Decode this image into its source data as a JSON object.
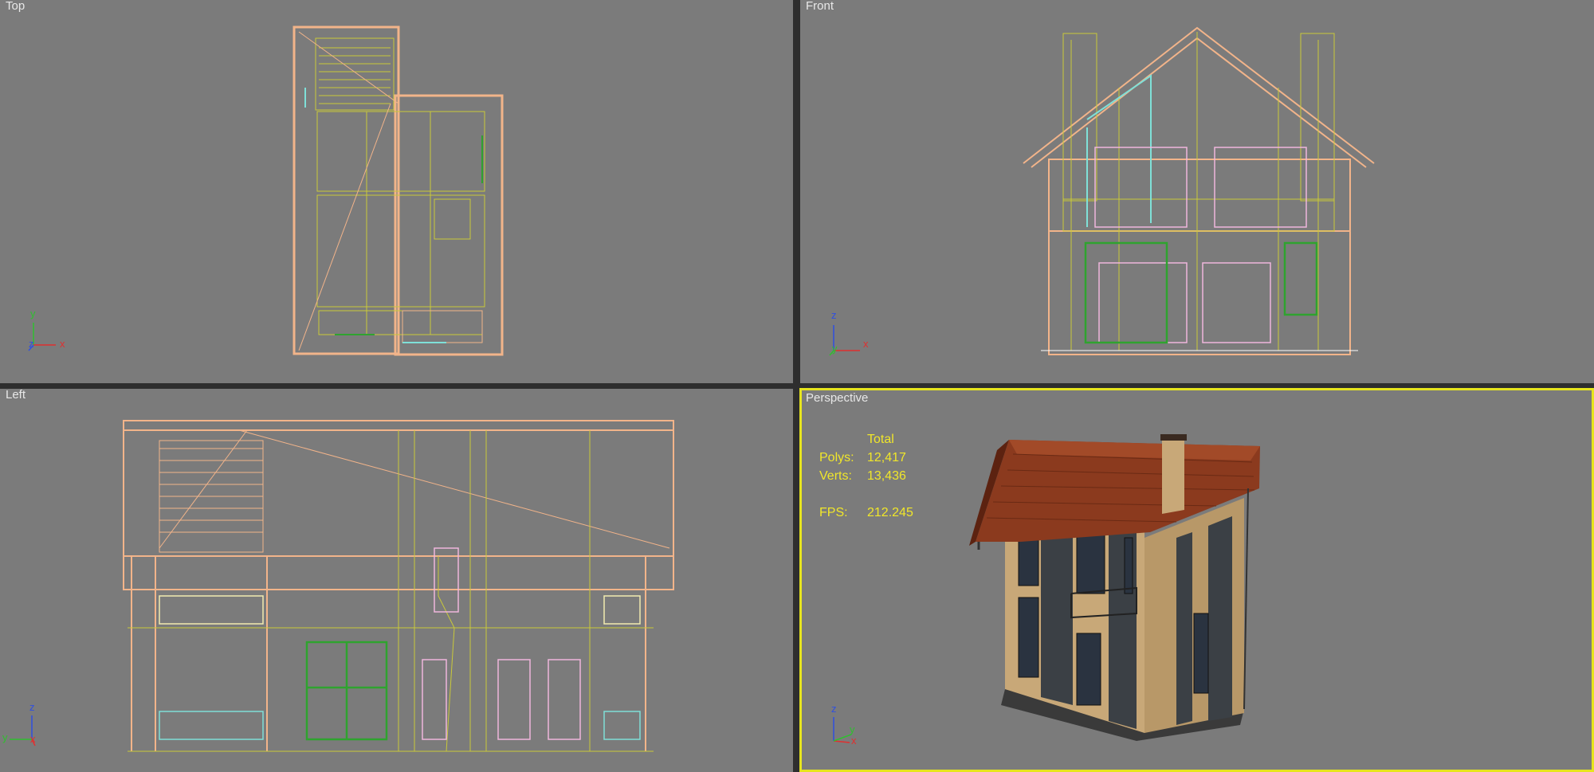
{
  "viewports": {
    "top": {
      "label": "Top"
    },
    "front": {
      "label": "Front"
    },
    "left": {
      "label": "Left"
    },
    "perspective": {
      "label": "Perspective",
      "active": true
    }
  },
  "stats": {
    "header": "Total",
    "polys_label": "Polys:",
    "polys_value": "12,417",
    "verts_label": "Verts:",
    "verts_value": "13,436",
    "fps_label": "FPS:",
    "fps_value": "212.245"
  },
  "axes": {
    "top": {
      "vertical": "y",
      "horizontal": "x",
      "depth": "z"
    },
    "front": {
      "vertical": "z",
      "horizontal": "x",
      "depth": "y"
    },
    "left": {
      "vertical": "z",
      "horizontal": "x",
      "depth": "y"
    },
    "perspective": {
      "vertical": "z",
      "horizontal": "x",
      "depth": "y"
    }
  },
  "colors": {
    "viewport_bg": "#7b7b7b",
    "active_border": "#e6e41e",
    "wire_main": "#f2b48a",
    "wire_yellow": "#c9c93a",
    "wire_green": "#2fa32f",
    "wire_pink": "#f0b6dc",
    "wire_cyan": "#7fe0d8",
    "roof": "#8b3a1e",
    "wall": "#c8a878",
    "stats_text": "#f0e62a"
  }
}
